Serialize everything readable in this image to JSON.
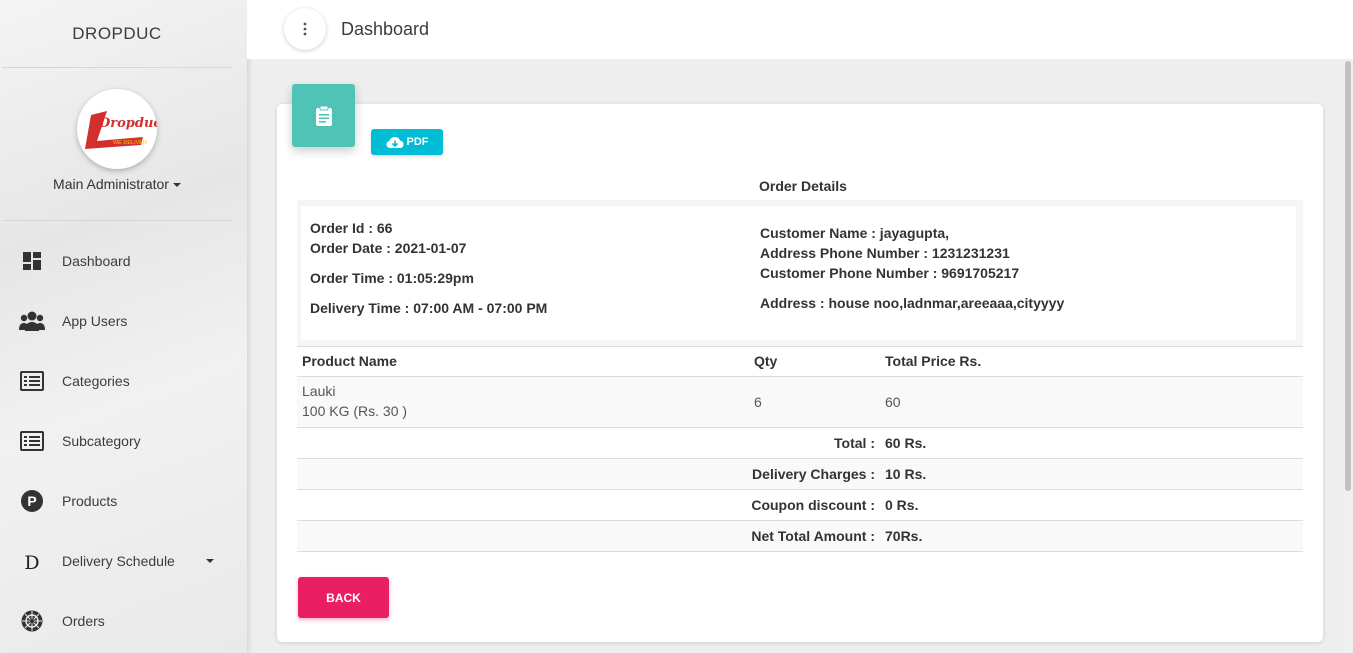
{
  "sidebar": {
    "brand": "DROPDUC",
    "logo": {
      "name": "Dropduc",
      "tagline": "WE DELIVER"
    },
    "user": "Main Administrator",
    "items": [
      {
        "label": "Dashboard",
        "icon": "dashboard-icon"
      },
      {
        "label": "App Users",
        "icon": "users-icon"
      },
      {
        "label": "Categories",
        "icon": "list-icon"
      },
      {
        "label": "Subcategory",
        "icon": "list-icon"
      },
      {
        "label": "Products",
        "icon": "products-p-icon"
      },
      {
        "label": "Delivery Schedule",
        "icon": "letter-d-icon"
      },
      {
        "label": "Orders",
        "icon": "orders-icon"
      }
    ]
  },
  "header": {
    "title": "Dashboard"
  },
  "card": {
    "pdf_label": "PDF",
    "section_title": "Order Details",
    "order": {
      "id": "Order Id : 66",
      "date": "Order Date : 2021-01-07",
      "time": "Order Time : 01:05:29pm",
      "delivery_time": "Delivery Time : 07:00 AM - 07:00 PM"
    },
    "customer": {
      "name": "Customer Name : jayagupta,",
      "address_phone": "Address Phone Number : 1231231231",
      "customer_phone": "Customer Phone Number : 9691705217",
      "address": "Address : house noo,ladnmar,areeaaa,cityyyy"
    },
    "table": {
      "headers": [
        "Product Name",
        "Qty",
        "Total Price Rs."
      ],
      "rows": [
        {
          "name": "Lauki",
          "detail": "100 KG (Rs. 30 )",
          "qty": "6",
          "total": "60"
        }
      ]
    },
    "summary": [
      {
        "label": "Total :",
        "value": "60 Rs."
      },
      {
        "label": "Delivery Charges :",
        "value": "10 Rs."
      },
      {
        "label": "Coupon discount :",
        "value": "0 Rs."
      },
      {
        "label": "Net Total Amount :",
        "value": "70Rs."
      }
    ],
    "back_label": "BACK"
  },
  "colors": {
    "card_icon": "#4fc3b5",
    "pdf_button": "#00bcd4",
    "back_button": "#e91e63",
    "logo_red": "#d32f2f",
    "logo_yellow": "#f9c400"
  }
}
